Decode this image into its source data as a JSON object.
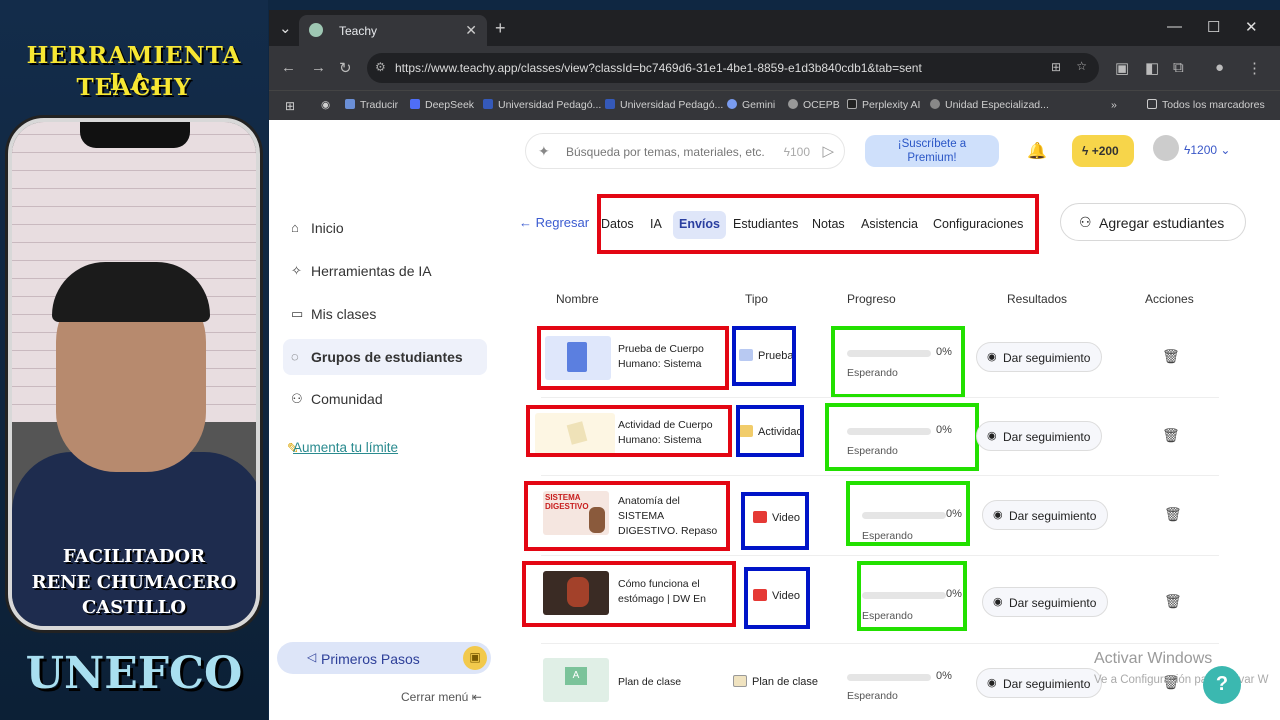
{
  "overlay": {
    "title_line1": "HERRAMIENTA I.A.",
    "title_line2": "TEACHY",
    "facilitator_line1": "FACILITADOR",
    "facilitator_line2": "RENE CHUMACERO",
    "facilitator_line3": "CASTILLO",
    "brand": "UNEFCO"
  },
  "browser": {
    "tab_title": "Teachy",
    "url": "https://www.teachy.app/classes/view?classId=bc7469d6-31e1-4be1-8859-e1d3b840cdb1&tab=sent",
    "bookmarks": [
      "Traducir",
      "DeepSeek",
      "Universidad Pedagó...",
      "Universidad Pedagó...",
      "Gemini",
      "OCEPB",
      "Perplexity AI",
      "Unidad Especializad..."
    ],
    "all_bookmarks": "Todos los marcadores"
  },
  "sidebar": {
    "items": [
      {
        "label": "Inicio",
        "icon": "home-icon"
      },
      {
        "label": "Herramientas de IA",
        "icon": "sparkle-icon"
      },
      {
        "label": "Mis clases",
        "icon": "folder-icon"
      },
      {
        "label": "Grupos de estudiantes",
        "icon": "apple-icon"
      },
      {
        "label": "Comunidad",
        "icon": "people-icon"
      }
    ],
    "active_index": 3,
    "upgrade_link": "Aumenta tu límite",
    "first_steps": "Primeros Pasos",
    "close_menu": "Cerrar menú"
  },
  "header": {
    "search_placeholder": "Búsqueda por temas, materiales, etc.",
    "search_cost": "100",
    "premium_line1": "¡Suscríbete a",
    "premium_line2": "Premium!",
    "bonus": "+200",
    "credits": "1200"
  },
  "class_nav": {
    "back": "Regresar",
    "tabs": [
      "Datos",
      "IA",
      "Envíos",
      "Estudiantes",
      "Notas",
      "Asistencia",
      "Configuraciones"
    ],
    "active_tab": "Envíos",
    "add_students": "Agregar estudiantes"
  },
  "table": {
    "headers": [
      "Nombre",
      "Tipo",
      "Progreso",
      "Resultados",
      "Acciones"
    ],
    "rows": [
      {
        "name": "Prueba de Cuerpo Humano: Sistema Digestivo",
        "type": "Prueba",
        "progress": "0%",
        "progress_value": 0,
        "status": "Esperando",
        "action": "Dar seguimiento"
      },
      {
        "name": "Actividad de Cuerpo Humano: Sistema Digestivo",
        "type": "Actividad",
        "progress": "0%",
        "progress_value": 0,
        "status": "Esperando",
        "action": "Dar seguimiento"
      },
      {
        "name": "Anatomía del SISTEMA DIGESTIVO. Repaso general",
        "type": "Video",
        "progress": "0%",
        "progress_value": 0,
        "status": "Esperando",
        "action": "Dar seguimiento"
      },
      {
        "name": "Cómo funciona el estómago | DW En forma",
        "type": "Video",
        "progress": "0%",
        "progress_value": 0,
        "status": "Esperando",
        "action": "Dar seguimiento"
      },
      {
        "name": "Plan de clase",
        "type": "Plan de clase",
        "progress": "0%",
        "progress_value": 0,
        "status": "Esperando",
        "action": "Dar seguimiento"
      }
    ]
  },
  "thumb_text": {
    "video1_line1": "SISTEMA",
    "video1_line2": "DIGESTIVO",
    "plan_letter": "A"
  },
  "windows": {
    "activate": "Activar Windows",
    "activate_sub": "Ve a Configuración para activar W"
  },
  "colors": {
    "annotation_red": "#e30613",
    "annotation_blue": "#0014c8",
    "annotation_green": "#22e000",
    "title_yellow": "#f7e733",
    "accent_blue": "#3b5bd0"
  }
}
